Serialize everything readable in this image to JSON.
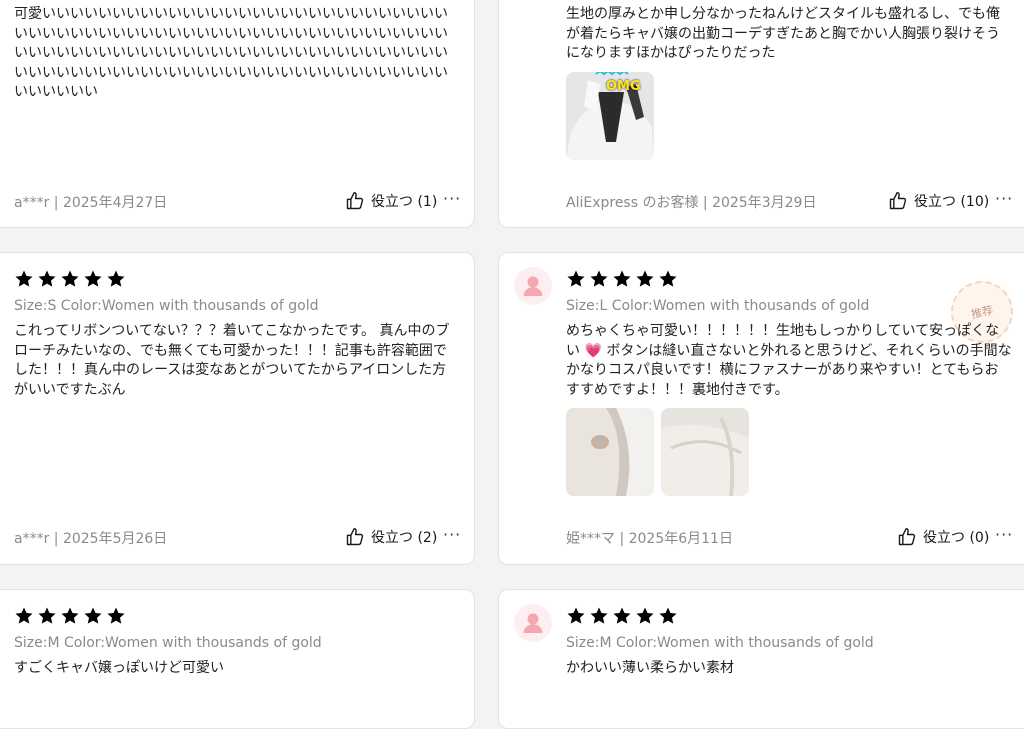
{
  "reviews": [
    {
      "body": "可愛いいいいいいいいいいいいいいいいいいいいいいいいいいいいいいいいいいいいいいいいいいいいいいいいいいいいいいいいいいいいいいいいいいいいいいいいいいいいいいいいいいいいいいいいいいいいいいいいいいいいいいいいいいいいいいいいいいいいいいいいいいいいいいいい",
      "author_date": "a***r | 2025年4月27日",
      "helpful": "役立つ (1)"
    },
    {
      "body": "生地の厚みとか申し分なかったねんけどスタイルも盛れるし、でも俺が着たらキャバ嬢の出勤コーデすぎたあと胸でかい人胸張り裂けそうになりますほかはぴったりだった",
      "image_overlay_text": "OMG",
      "author_date": "AliExpress のお客様 | 2025年3月29日",
      "helpful": "役立つ (10)"
    },
    {
      "rating": 5,
      "sku": "Size:S Color:Women with thousands of gold",
      "body": "これってリボンついてない？？？着いてこなかったです。 真ん中のブローチみたいなの、でも無くても可愛かった！！！記事も許容範囲でした！！！真ん中のレースは変なあとがついてたからアイロンした方がいいですたぶん",
      "author_date": "a***r | 2025年5月26日",
      "helpful": "役立つ (2)"
    },
    {
      "rating": 5,
      "sku": "Size:L Color:Women with thousands of gold",
      "body_before_emoji": "めちゃくちゃ可愛い！！！！！！生地もしっかりしていて安っぽくない",
      "emoji": "💗",
      "body_after_emoji": " ボタンは縫い直さないと外れると思うけど、それくらいの手間なかなりコスパ良いです！横にファスナーがあり来やすい！とてもらおすすめですよ！！！裏地付きです。",
      "badge": "推荐",
      "author_date": "姫***マ | 2025年6月11日",
      "helpful": "役立つ (0)"
    },
    {
      "rating": 5,
      "sku": "Size:M Color:Women with thousands of gold",
      "body": "すごくキャバ嬢っぽいけど可愛い"
    },
    {
      "rating": 5,
      "sku": "Size:M Color:Women with thousands of gold",
      "body": "かわいい薄い柔らかい素材"
    }
  ],
  "more_label": "···",
  "colors": {
    "star": "#fdbb00",
    "avatar_bg": "#fdeef1",
    "muted": "#8a8a8a"
  }
}
